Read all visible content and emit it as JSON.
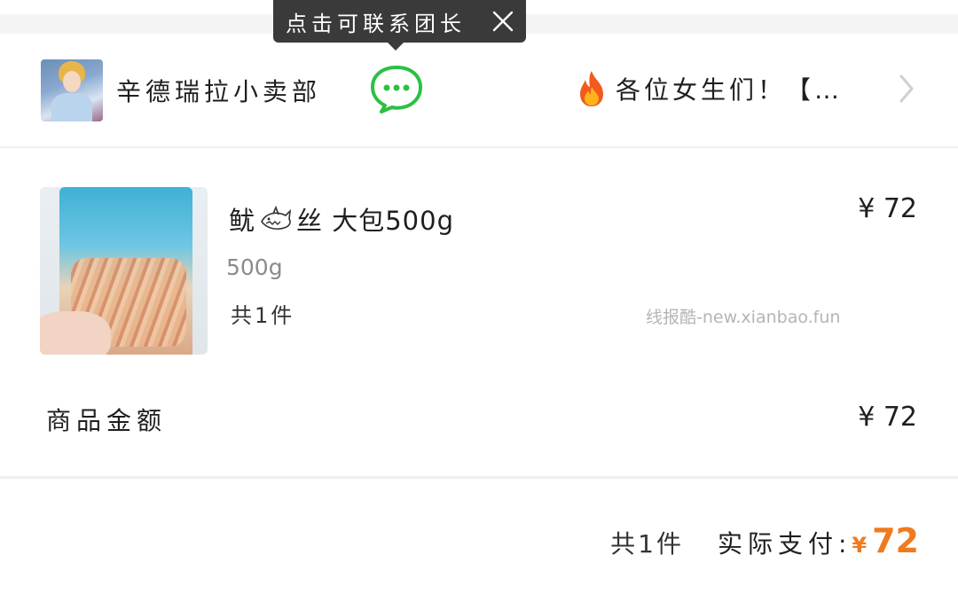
{
  "tooltip": {
    "text": "点击可联系团长"
  },
  "shop": {
    "name": "辛德瑞拉小卖部",
    "notice": "各位女生们！【…"
  },
  "product": {
    "title_part1": "鱿",
    "title_part2": "丝 大包500g",
    "spec": "500g",
    "quantity": "共1件",
    "price": "¥ 72"
  },
  "watermark": "线报酷-new.xianbao.fun",
  "summary": {
    "amount_label": "商品金额",
    "amount_value": "¥ 72"
  },
  "footer": {
    "quantity": "共1件",
    "pay_label": "实际支付:",
    "currency": "¥",
    "pay_value": "72"
  },
  "colors": {
    "accent_orange": "#f07a20",
    "chat_green": "#2bc142",
    "tooltip_bg": "#3a3a3a"
  },
  "icons": [
    "close-icon",
    "chat-icon",
    "fire-icon",
    "chevron-right-icon",
    "shark-icon"
  ]
}
